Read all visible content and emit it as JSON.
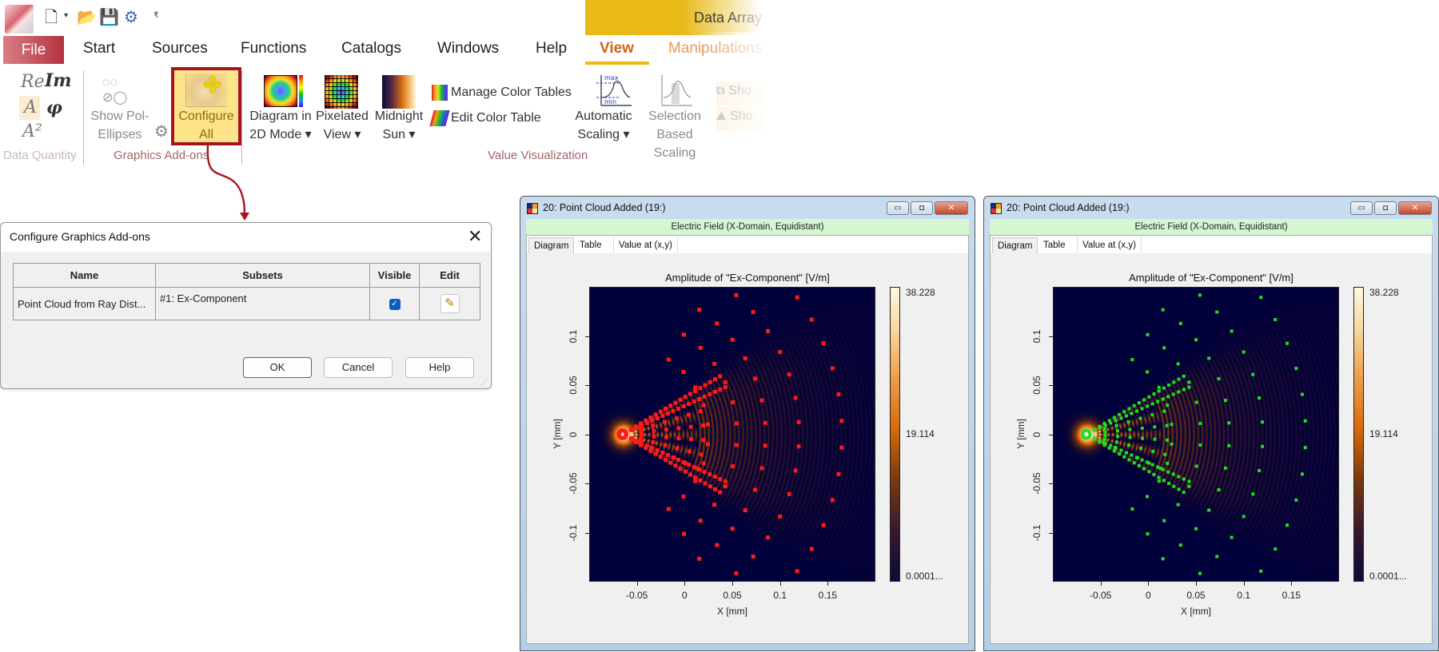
{
  "quick_access": {
    "icons": [
      "app-logo",
      "new-document-icon",
      "open-folder-icon",
      "save-icon",
      "settings-window-icon",
      "customize-caret-icon"
    ]
  },
  "contextual_tab_group": "Data Array",
  "ribbon": {
    "tabs": [
      {
        "label": "File"
      },
      {
        "label": "Start"
      },
      {
        "label": "Sources"
      },
      {
        "label": "Functions"
      },
      {
        "label": "Catalogs"
      },
      {
        "label": "Windows"
      },
      {
        "label": "Help"
      },
      {
        "label": "View",
        "active": true
      },
      {
        "label": "Manipulations"
      }
    ],
    "groups": {
      "data_quantity": {
        "label": "Data Quantity",
        "buttons": [
          "Re",
          "Im",
          "A",
          "φ",
          "A²"
        ]
      },
      "graphics_addons": {
        "label": "Graphics Add-ons",
        "show_pol": [
          "Show Pol-",
          "Ellipses"
        ],
        "configure": [
          "Configure",
          "All"
        ]
      },
      "value_visualization": {
        "label": "Value Visualization",
        "diagram_2d": [
          "Diagram in",
          "2D Mode ▾"
        ],
        "pixelated": [
          "Pixelated",
          "View ▾"
        ],
        "midnight": [
          "Midnight",
          "Sun ▾"
        ],
        "manage_color_tables": "Manage Color Tables",
        "edit_color_table": "Edit Color Table",
        "automatic_scaling": [
          "Automatic",
          "Scaling ▾"
        ],
        "selection_scaling": [
          "Selection",
          "Based Scaling"
        ],
        "show_1": "Sho",
        "show_2": "Sho",
        "scale_icon_max": "max",
        "scale_icon_min": "min"
      }
    }
  },
  "dialog": {
    "title": "Configure Graphics Add-ons",
    "columns": [
      "Name",
      "Subsets",
      "Visible",
      "Edit"
    ],
    "rows": [
      {
        "name": "Point Cloud from Ray Dist...",
        "subsets": "#1: Ex-Component",
        "visible": true
      }
    ],
    "buttons": {
      "ok": "OK",
      "cancel": "Cancel",
      "help": "Help"
    },
    "close_glyph": "✕"
  },
  "windows": [
    {
      "title": "20: Point Cloud Added (19:)",
      "subtitle": "Electric Field (X-Domain, Equidistant)",
      "tabs": [
        "Diagram",
        "Table",
        "Value at (x,y)"
      ],
      "active_tab": "Diagram",
      "point_color": "#ff1a1a"
    },
    {
      "title": "20: Point Cloud Added (19:)",
      "subtitle": "Electric Field (X-Domain, Equidistant)",
      "tabs": [
        "Diagram",
        "Table",
        "Value at (x,y)"
      ],
      "active_tab": "Diagram",
      "point_color": "#1ee01e"
    }
  ],
  "chart_data": [
    {
      "type": "heatmap",
      "title": "Amplitude of \"Ex-Component\"  [V/m]",
      "xlabel": "X [mm]",
      "ylabel": "Y [mm]",
      "xlim": [
        -0.1,
        0.2
      ],
      "ylim": [
        -0.15,
        0.15
      ],
      "xticks": [
        "-0.05",
        "0",
        "0.05",
        "0.1",
        "0.15"
      ],
      "xtick_values": [
        -0.05,
        0,
        0.05,
        0.1,
        0.15
      ],
      "yticks": [
        "0.1",
        "0.05",
        "0",
        "-0.05",
        "-0.1"
      ],
      "ytick_values": [
        0.1,
        0.05,
        0,
        -0.05,
        -0.1
      ],
      "colorbar": {
        "max": "38.228",
        "mid": "19.114",
        "min": "0.0001..."
      },
      "overlay": "point cloud (red)",
      "source_x": -0.065,
      "ring_radii": [
        0.03,
        0.06,
        0.09,
        0.12,
        0.15,
        0.185,
        0.23
      ],
      "cone_half_angle_deg": 30
    },
    {
      "type": "heatmap",
      "title": "Amplitude of \"Ex-Component\"  [V/m]",
      "xlabel": "X [mm]",
      "ylabel": "Y [mm]",
      "xlim": [
        -0.1,
        0.2
      ],
      "ylim": [
        -0.15,
        0.15
      ],
      "xticks": [
        "-0.05",
        "0",
        "0.05",
        "0.1",
        "0.15"
      ],
      "xtick_values": [
        -0.05,
        0,
        0.05,
        0.1,
        0.15
      ],
      "yticks": [
        "0.1",
        "0.05",
        "0",
        "-0.05",
        "-0.1"
      ],
      "ytick_values": [
        0.1,
        0.05,
        0,
        -0.05,
        -0.1
      ],
      "colorbar": {
        "max": "38.228",
        "mid": "19.114",
        "min": "0.0001..."
      },
      "overlay": "point cloud (green)",
      "source_x": -0.065,
      "ring_radii": [
        0.03,
        0.06,
        0.09,
        0.12,
        0.15,
        0.185,
        0.23
      ],
      "cone_half_angle_deg": 30
    }
  ]
}
